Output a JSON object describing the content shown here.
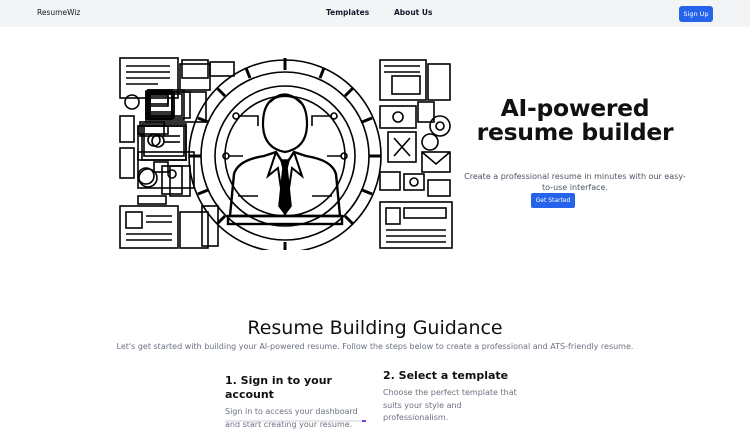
{
  "header": {
    "brand": "ResumeWiz",
    "nav": [
      "Templates",
      "About Us"
    ],
    "signup_label": "Sign Up"
  },
  "hero": {
    "title": "AI-powered resume builder",
    "subtitle": "Create a professional resume in minutes with our easy-to-use interface.",
    "cta_label": "Get Started",
    "image_icon": "resume-illustration-icon"
  },
  "guidance": {
    "title": "Resume Building Guidance",
    "subtitle": "Let's get started with building your AI-powered resume. Follow the steps below to create a professional and ATS-friendly resume.",
    "steps": [
      {
        "title": "1. Sign in to your account",
        "text": "Sign in to access your dashboard and start creating your resume."
      },
      {
        "title": "2. Select a template",
        "text": "Choose the perfect template that suits your style and professionalism."
      }
    ]
  },
  "colors": {
    "accent": "#2563eb",
    "header_bg": "#f3f4f6"
  }
}
